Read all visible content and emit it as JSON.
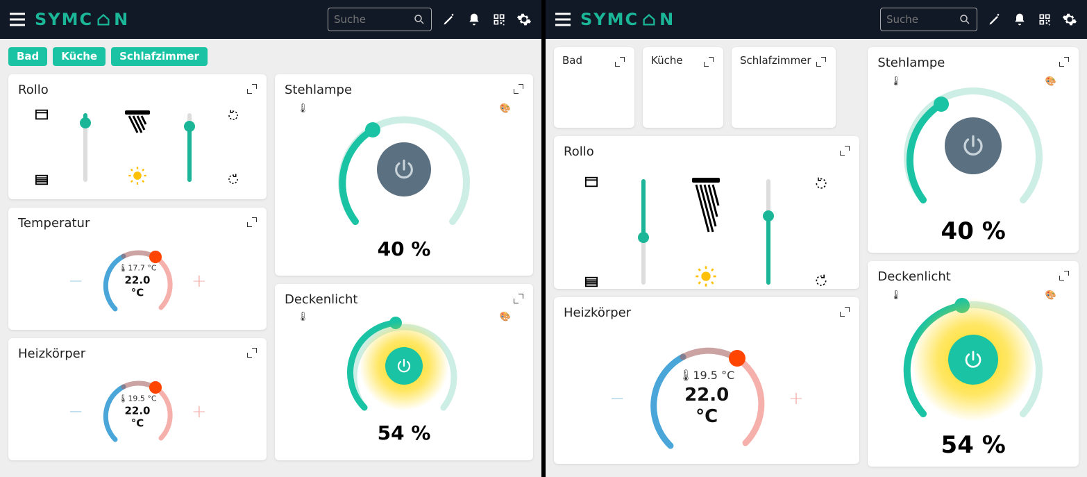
{
  "brand": "SYMCON",
  "search_placeholder": "Suche",
  "rooms": [
    "Bad",
    "Küche",
    "Schlafzimmer"
  ],
  "left": {
    "rollo": {
      "title": "Rollo",
      "shade_pct": 15,
      "sun_pct": 80
    },
    "temperatur": {
      "title": "Temperatur",
      "current": "17.7 °C",
      "set": "22.0 °C"
    },
    "heizkorper": {
      "title": "Heizkörper",
      "current": "19.5 °C",
      "set": "22.0 °C"
    },
    "stehlampe": {
      "title": "Stehlampe",
      "value": "40 %",
      "on": false,
      "arc_pct": 40
    },
    "deckenlicht": {
      "title": "Deckenlicht",
      "value": "54 %",
      "on": true,
      "arc_pct": 54
    }
  },
  "right": {
    "rollo": {
      "title": "Rollo",
      "shade_pct": 55,
      "sun_pct": 65
    },
    "heizkorper": {
      "title": "Heizkörper",
      "current": "19.5 °C",
      "set": "22.0 °C"
    },
    "stehlampe": {
      "title": "Stehlampe",
      "value": "40 %",
      "on": false,
      "arc_pct": 40
    },
    "deckenlicht": {
      "title": "Deckenlicht",
      "value": "54 %",
      "on": true,
      "arc_pct": 54
    }
  }
}
